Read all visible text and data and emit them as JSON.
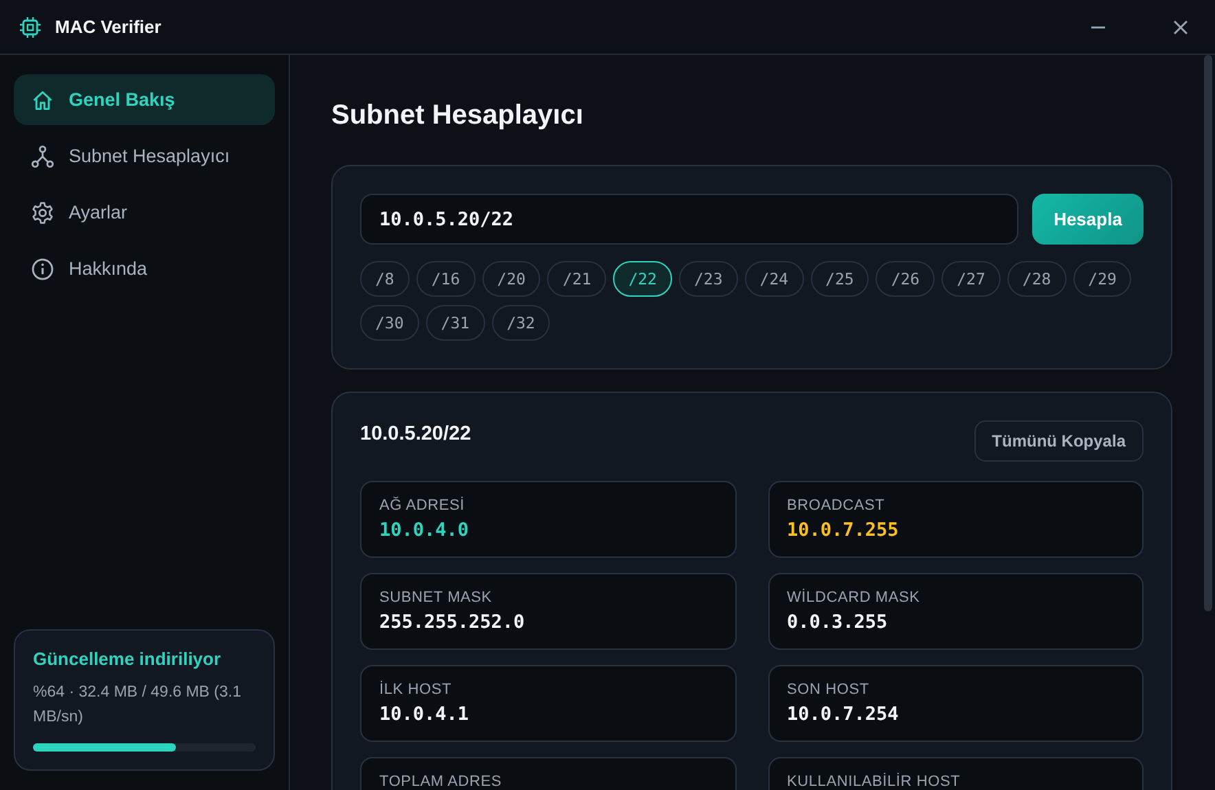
{
  "window": {
    "title": "MAC Verifier"
  },
  "sidebar": {
    "items": [
      {
        "label": "Genel Bakış",
        "selected": true
      },
      {
        "label": "Subnet Hesaplayıcı",
        "selected": false
      },
      {
        "label": "Ayarlar",
        "selected": false
      },
      {
        "label": "Hakkında",
        "selected": false
      }
    ],
    "update": {
      "title": "Güncelleme indiriliyor",
      "detail": "%64 · 32.4 MB / 49.6 MB (3.1 MB/sn)",
      "level": 0.64
    }
  },
  "page": {
    "title": "Subnet Hesaplayıcı",
    "input": {
      "value": "10.0.5.20/22"
    },
    "calculate_button": "Hesapla",
    "prefixes": [
      {
        "label": "/8",
        "selected": false
      },
      {
        "label": "/16",
        "selected": false
      },
      {
        "label": "/20",
        "selected": false
      },
      {
        "label": "/21",
        "selected": false
      },
      {
        "label": "/22",
        "selected": true
      },
      {
        "label": "/23",
        "selected": false
      },
      {
        "label": "/24",
        "selected": false
      },
      {
        "label": "/25",
        "selected": false
      },
      {
        "label": "/26",
        "selected": false
      },
      {
        "label": "/27",
        "selected": false
      },
      {
        "label": "/28",
        "selected": false
      },
      {
        "label": "/29",
        "selected": false
      },
      {
        "label": "/30",
        "selected": false
      },
      {
        "label": "/31",
        "selected": false
      },
      {
        "label": "/32",
        "selected": false
      }
    ],
    "result": {
      "title": "10.0.5.20/22",
      "copy_button": "Tümünü Kopyala",
      "fields": [
        {
          "label": "AĞ ADRESİ",
          "value": "10.0.4.0",
          "color": "#2dd4bf"
        },
        {
          "label": "BROADCAST",
          "value": "10.0.7.255",
          "color": "#fbbf24"
        },
        {
          "label": "SUBNET MASK",
          "value": "255.255.252.0",
          "color": "#f3f4f6"
        },
        {
          "label": "WİLDCARD MASK",
          "value": "0.0.3.255",
          "color": "#f3f4f6"
        },
        {
          "label": "İLK HOST",
          "value": "10.0.4.1",
          "color": "#f3f4f6"
        },
        {
          "label": "SON HOST",
          "value": "10.0.7.254",
          "color": "#f3f4f6"
        },
        {
          "label": "TOPLAM ADRES"
        },
        {
          "label": "KULLANILABİLİR HOST"
        }
      ]
    }
  }
}
